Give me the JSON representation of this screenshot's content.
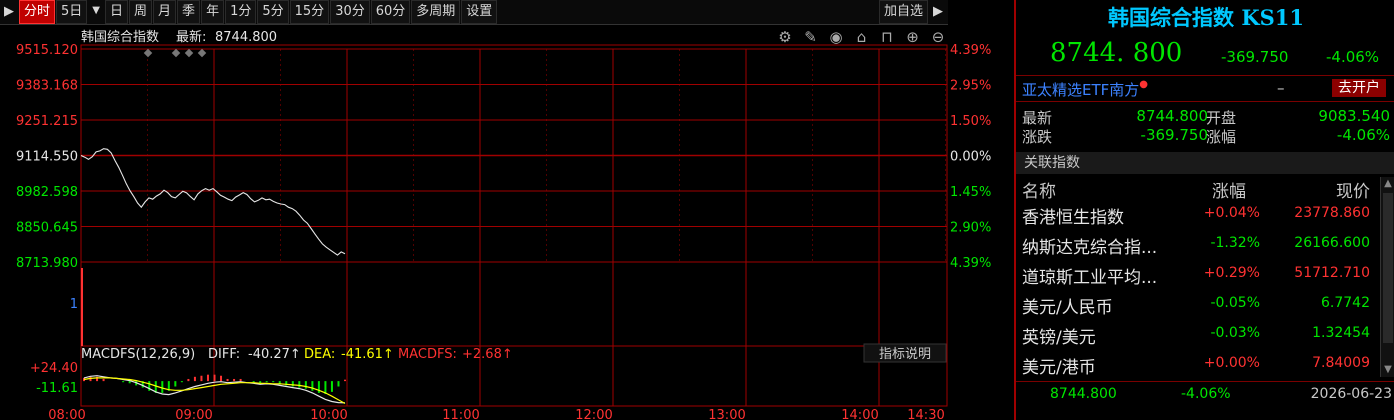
{
  "toolbar": {
    "items": [
      "分时",
      "5日",
      "日",
      "周",
      "月",
      "季",
      "年",
      "1分",
      "5分",
      "15分",
      "30分",
      "60分",
      "多周期",
      "设置"
    ],
    "active_index": 0,
    "add_watch": "加自选"
  },
  "chart": {
    "name": "韩国综合指数",
    "latest_label": "最新:",
    "latest_value": "8744.800",
    "price_labels": [
      "9515.120",
      "9383.168",
      "9251.215",
      "9114.550",
      "8982.598",
      "8850.645",
      "8713.980"
    ],
    "pct_labels": [
      "4.39%",
      "2.95%",
      "1.50%",
      "0.00%",
      "1.45%",
      "2.90%",
      "4.39%"
    ],
    "volume_label": "1",
    "time_labels": [
      "08:00",
      "09:00",
      "10:00",
      "11:00",
      "12:00",
      "13:00",
      "14:00",
      "14:30"
    ],
    "colors": {
      "up": "#ff3232",
      "down": "#00e600",
      "grid": "#a00000",
      "line": "#e6e6e6"
    }
  },
  "macd": {
    "name": "MACDFS(12,26,9)",
    "diff_label": "DIFF:",
    "diff_value": "-40.27↑",
    "dea_label": "DEA:",
    "dea_value": "-41.61↑",
    "macd_label": "MACDFS:",
    "macd_value": "+2.68↑",
    "help": "指标说明",
    "axis_top": "+24.40",
    "axis_mid": "-11.61"
  },
  "chart_data": {
    "type": "line",
    "x_start": "09:00",
    "price_series": [
      9114.55,
      9108,
      9100,
      9110,
      9128,
      9132,
      9140,
      9138,
      9124,
      9096,
      9070,
      9040,
      9008,
      8982,
      8960,
      8936,
      8920,
      8940,
      8955,
      8950,
      8962,
      8970,
      8984,
      8975,
      8960,
      8955,
      8968,
      8980,
      8974,
      8960,
      8948,
      8970,
      8982,
      8990,
      8984,
      8990,
      8978,
      8965,
      8958,
      8950,
      8945,
      8958,
      8966,
      8975,
      8968,
      8952,
      8940,
      8946,
      8955,
      8948,
      8950,
      8942,
      8936,
      8932,
      8930,
      8920,
      8915,
      8905,
      8890,
      8872,
      8860,
      8840,
      8820,
      8800,
      8782,
      8770,
      8760,
      8750,
      8740,
      8752,
      8744.8
    ],
    "prev_close": 9114.55,
    "ylim": [
      8713.98,
      9515.12
    ],
    "diff_series": [
      6,
      9,
      10,
      8,
      6,
      5,
      3,
      1,
      -3,
      -8,
      -14,
      -20,
      -24,
      -25,
      -22,
      -18,
      -14,
      -10,
      -7,
      -4,
      -2,
      -1,
      -3,
      -2,
      -1,
      -3,
      -4,
      -6,
      -5,
      -6,
      -8,
      -10,
      -12,
      -14,
      -17,
      -22,
      -28,
      -34,
      -38,
      -40,
      -40.27
    ],
    "dea_series": [
      3,
      5,
      6,
      6,
      6,
      5,
      4,
      3,
      1,
      -2,
      -5,
      -9,
      -13,
      -16,
      -17,
      -17,
      -16,
      -14,
      -12,
      -10,
      -8,
      -6,
      -5,
      -4,
      -3,
      -3,
      -3,
      -4,
      -4,
      -5,
      -5,
      -6,
      -7,
      -8,
      -10,
      -13,
      -17,
      -22,
      -28,
      -35,
      -41.61
    ],
    "macd_series": [
      6,
      8,
      8,
      4,
      0,
      0,
      -2,
      -4,
      -8,
      -12,
      -18,
      -22,
      -22,
      -18,
      -10,
      -2,
      4,
      8,
      10,
      12,
      12,
      10,
      4,
      4,
      4,
      0,
      -2,
      -4,
      -2,
      -2,
      -6,
      -8,
      -10,
      -12,
      -14,
      -18,
      -22,
      -24,
      -20,
      -10,
      2.68
    ]
  },
  "panel": {
    "title": "韩国综合指数 KS11",
    "price": "8744. 800",
    "change": "-369.750",
    "pct": "-4.06%",
    "etf_name": "亚太精选ETF南方",
    "etf_dash": "–",
    "etf_button": "去开户",
    "quote": {
      "latest_label": "最新",
      "latest_value": "8744.800",
      "open_label": "开盘",
      "open_value": "9083.540",
      "chg_label": "涨跌",
      "chg_value": "-369.750",
      "pct_label": "涨幅",
      "pct_value": "-4.06%"
    },
    "related_header": "关联指数",
    "cols": {
      "name": "名称",
      "chg": "涨幅",
      "price": "现价"
    },
    "related": [
      {
        "name": "香港恒生指数",
        "chg": "+0.04%",
        "price": "23778.860",
        "dir": "up"
      },
      {
        "name": "纳斯达克综合指...",
        "chg": "-1.32%",
        "price": "26166.600",
        "dir": "down"
      },
      {
        "name": "道琼斯工业平均...",
        "chg": "+0.29%",
        "price": "51712.710",
        "dir": "up"
      },
      {
        "name": "美元/人民币",
        "chg": "-0.05%",
        "price": "6.7742",
        "dir": "down"
      },
      {
        "name": "英镑/美元",
        "chg": "-0.03%",
        "price": "1.32454",
        "dir": "down"
      },
      {
        "name": "美元/港币",
        "chg": "+0.00%",
        "price": "7.84009",
        "dir": "up"
      }
    ],
    "bottom": {
      "price": "8744.800",
      "pct": "-4.06%",
      "date": "2026-06-23"
    }
  }
}
